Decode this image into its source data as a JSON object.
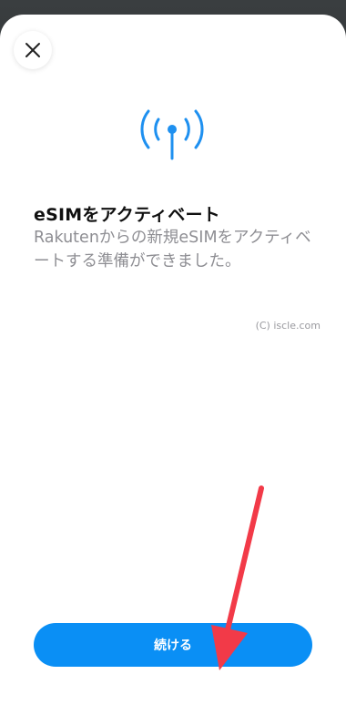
{
  "dialog": {
    "title": "eSIMをアクティベート",
    "description": "Rakutenからの新規eSIMをアクティベートする準備ができました。",
    "watermark": "(C) iscle.com",
    "continue_label": "続ける"
  },
  "icons": {
    "close": "close-icon",
    "signal": "cellular-antenna-icon",
    "annotation": "red-arrow"
  },
  "colors": {
    "accent": "#0a8ff5",
    "icon_blue": "#1e90f0",
    "annotation_red": "#f23a48"
  }
}
